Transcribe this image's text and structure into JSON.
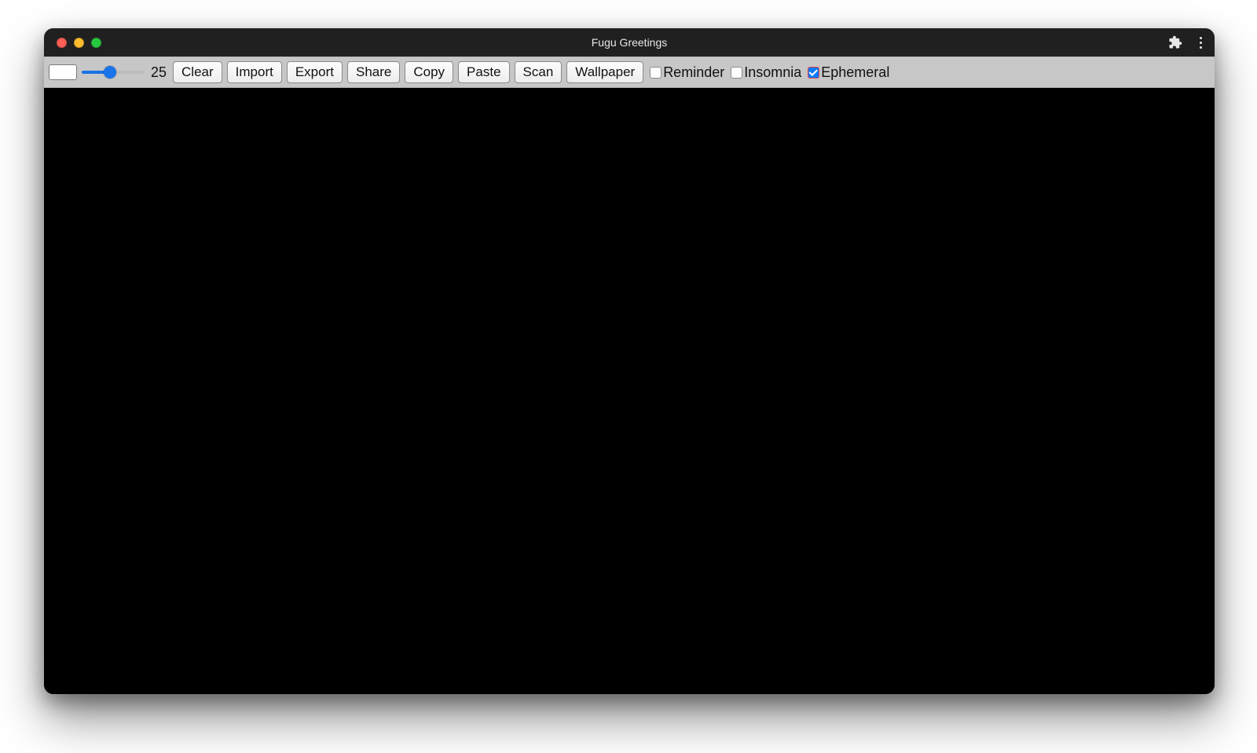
{
  "window": {
    "title": "Fugu Greetings"
  },
  "toolbar": {
    "slider_value": "25",
    "buttons": {
      "clear": "Clear",
      "import": "Import",
      "export": "Export",
      "share": "Share",
      "copy": "Copy",
      "paste": "Paste",
      "scan": "Scan",
      "wallpaper": "Wallpaper"
    },
    "checkboxes": {
      "reminder": {
        "label": "Reminder",
        "checked": false
      },
      "insomnia": {
        "label": "Insomnia",
        "checked": false
      },
      "ephemeral": {
        "label": "Ephemeral",
        "checked": true
      }
    }
  },
  "colors": {
    "titlebar_bg": "#202020",
    "toolbar_bg": "#c7c7c7",
    "canvas_bg": "#000000",
    "accent": "#1a73e8"
  }
}
